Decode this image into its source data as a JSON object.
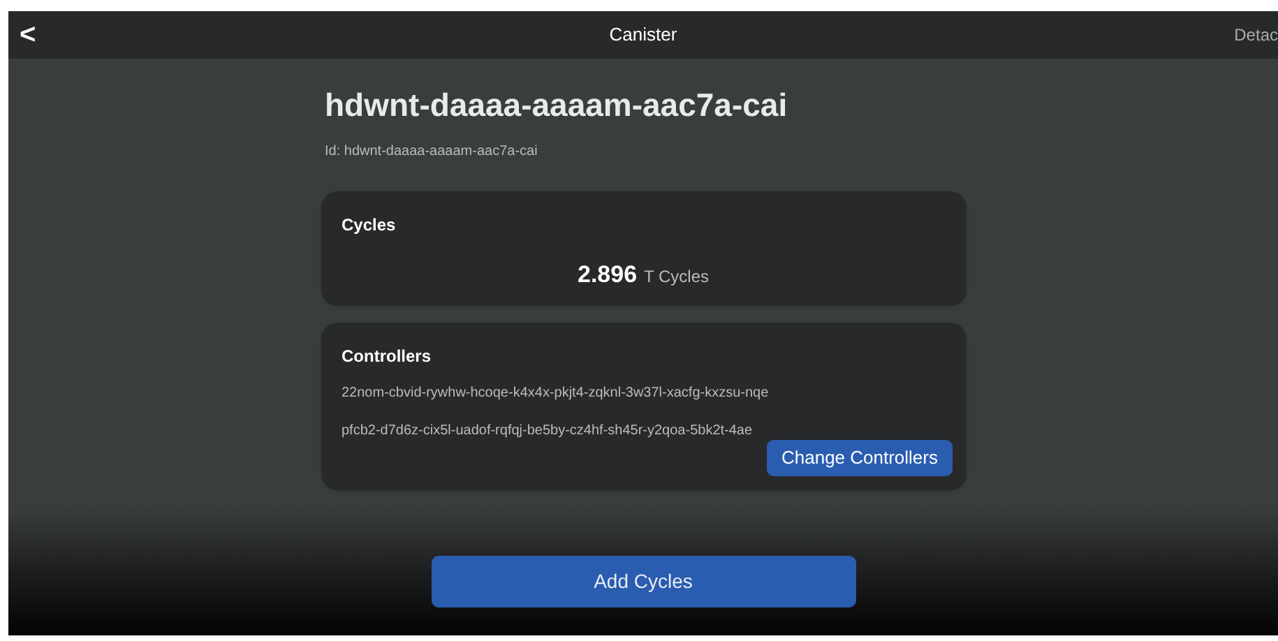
{
  "header": {
    "back": "<",
    "title": "Canister",
    "action": "Detac"
  },
  "canister": {
    "name": "hdwnt-daaaa-aaaam-aac7a-cai",
    "id_line": "Id: hdwnt-daaaa-aaaam-aac7a-cai"
  },
  "cycles": {
    "heading": "Cycles",
    "amount": "2.896",
    "unit": "T Cycles"
  },
  "controllers": {
    "heading": "Controllers",
    "items": [
      "22nom-cbvid-rywhw-hcoqe-k4x4x-pkjt4-zqknl-3w37l-xacfg-kxzsu-nqe",
      "pfcb2-d7d6z-cix5l-uadof-rqfqj-be5by-cz4hf-sh45r-y2qoa-5bk2t-4ae"
    ],
    "button": "Change Controllers"
  },
  "footer": {
    "button": "Add Cycles"
  }
}
